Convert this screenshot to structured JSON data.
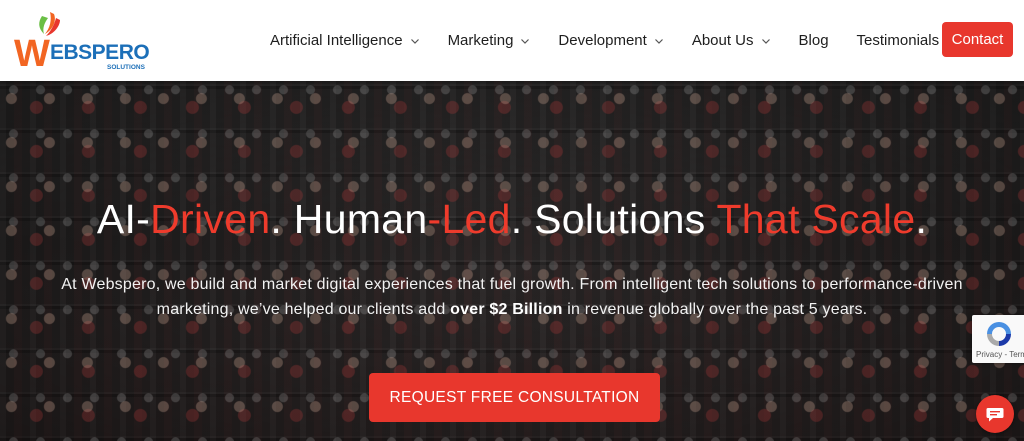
{
  "logo": {
    "brand": "WEBSPERO",
    "tagline": "SOLUTIONS"
  },
  "nav": {
    "items": [
      {
        "label": "Artificial Intelligence",
        "dropdown": true
      },
      {
        "label": "Marketing",
        "dropdown": true
      },
      {
        "label": "Development",
        "dropdown": true
      },
      {
        "label": "About Us",
        "dropdown": true
      },
      {
        "label": "Blog",
        "dropdown": false
      },
      {
        "label": "Testimonials",
        "dropdown": false
      }
    ],
    "contact_label": "Contact"
  },
  "hero": {
    "title": {
      "p1": "AI-",
      "p2": "Driven",
      "p3": ". Human",
      "p4": "-Led",
      "p5": ". Solutions ",
      "p6": "That Scale",
      "p7": "."
    },
    "description": {
      "before": "At Webspero, we build and market digital experiences that fuel growth. From intelligent tech solutions to performance-driven marketing, we’ve helped our clients add ",
      "bold": "over $2 Billion",
      "after": " in revenue globally over the past 5 years."
    },
    "cta_label": "REQUEST FREE CONSULTATION"
  },
  "recaptcha": {
    "text": "Privacy - Terms"
  },
  "icons": {
    "chevron": "chevron-down-icon",
    "chat": "chat-bubble-icon",
    "recaptcha": "recaptcha-icon"
  },
  "colors": {
    "accent": "#e8372d",
    "title_red": "#ee3b2c",
    "logo_blue": "#1c6fb8",
    "logo_orange": "#f26522",
    "logo_green": "#6abf45"
  }
}
